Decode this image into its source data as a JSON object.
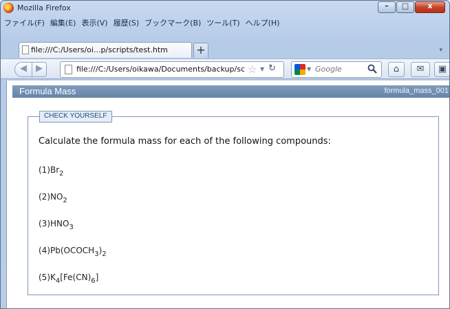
{
  "window": {
    "title": "Mozilla Firefox"
  },
  "window_controls": {
    "minimize": "–",
    "maximize": "□",
    "close": "x"
  },
  "menu": {
    "items": [
      "ファイル(F)",
      "編集(E)",
      "表示(V)",
      "履歴(S)",
      "ブックマーク(B)",
      "ツール(T)",
      "ヘルプ(H)"
    ]
  },
  "tab": {
    "title": "file:///C:/Users/oi...p/scripts/test.htm",
    "new_tab": "+"
  },
  "navbar": {
    "url": "file:///C:/Users/oikawa/Documents/backup/scr",
    "search_placeholder": "Google"
  },
  "page": {
    "header_title": "Formula Mass",
    "header_id": "formula_mass_001",
    "box_label": "CHECK YOURSELF",
    "prompt": "Calculate the formula mass for each of the following compounds:",
    "questions": [
      {
        "num": "(1)",
        "parts": [
          {
            "t": "Br"
          },
          {
            "s": "2"
          }
        ]
      },
      {
        "num": "(2)",
        "parts": [
          {
            "t": "NO"
          },
          {
            "s": "2"
          }
        ]
      },
      {
        "num": "(3)",
        "parts": [
          {
            "t": "HNO"
          },
          {
            "s": "3"
          }
        ]
      },
      {
        "num": "(4)",
        "parts": [
          {
            "t": "Pb(OCOCH"
          },
          {
            "s": "3"
          },
          {
            "t": ")"
          },
          {
            "s": "2"
          }
        ]
      },
      {
        "num": "(5)",
        "parts": [
          {
            "t": "K"
          },
          {
            "s": "4"
          },
          {
            "t": "[Fe(CN)"
          },
          {
            "s": "6"
          },
          {
            "t": "]"
          }
        ]
      }
    ]
  },
  "icons": {
    "back": "arrow-left-icon",
    "forward": "arrow-right-icon",
    "bookmark": "star-icon",
    "reload": "reload-icon",
    "search": "magnifier-icon",
    "home": "home-icon"
  },
  "colors": {
    "header_bg": "#6e8db2",
    "box_border": "#7e98b5",
    "label_text": "#244a78"
  }
}
